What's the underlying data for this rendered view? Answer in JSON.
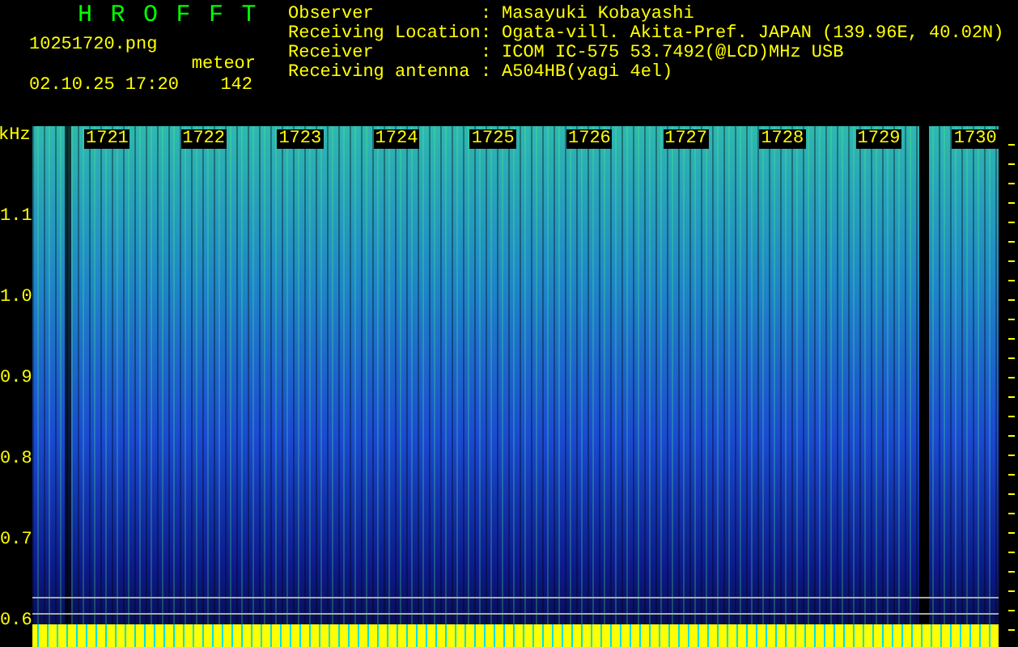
{
  "title": "HROFFT",
  "file": "10251720.png",
  "datetime": "02.10.25 17:20",
  "meteor_label": "meteor",
  "meteor_count": "142",
  "info": [
    {
      "label": "Observer",
      "separator": ":",
      "value": "Masayuki Kobayashi"
    },
    {
      "label": "Receiving Location",
      "separator": ":",
      "value": "Ogata-vill. Akita-Pref. JAPAN (139.96E, 40.02N)"
    },
    {
      "label": "Receiver",
      "separator": ":",
      "value": "ICOM IC-575 53.7492(@LCD)MHz USB"
    },
    {
      "label": "Receiving antenna",
      "separator": ":",
      "value": "A504HB(yagi 4el)"
    }
  ],
  "spectrogram": {
    "unit": "kHz",
    "frequency_labels": [
      "1.1",
      "1.0",
      "0.9",
      "0.8",
      "0.7",
      "0.6"
    ],
    "time_labels": [
      "1721",
      "1722",
      "1723",
      "1724",
      "1725",
      "1726",
      "1727",
      "1728",
      "1729",
      "1730"
    ]
  }
}
